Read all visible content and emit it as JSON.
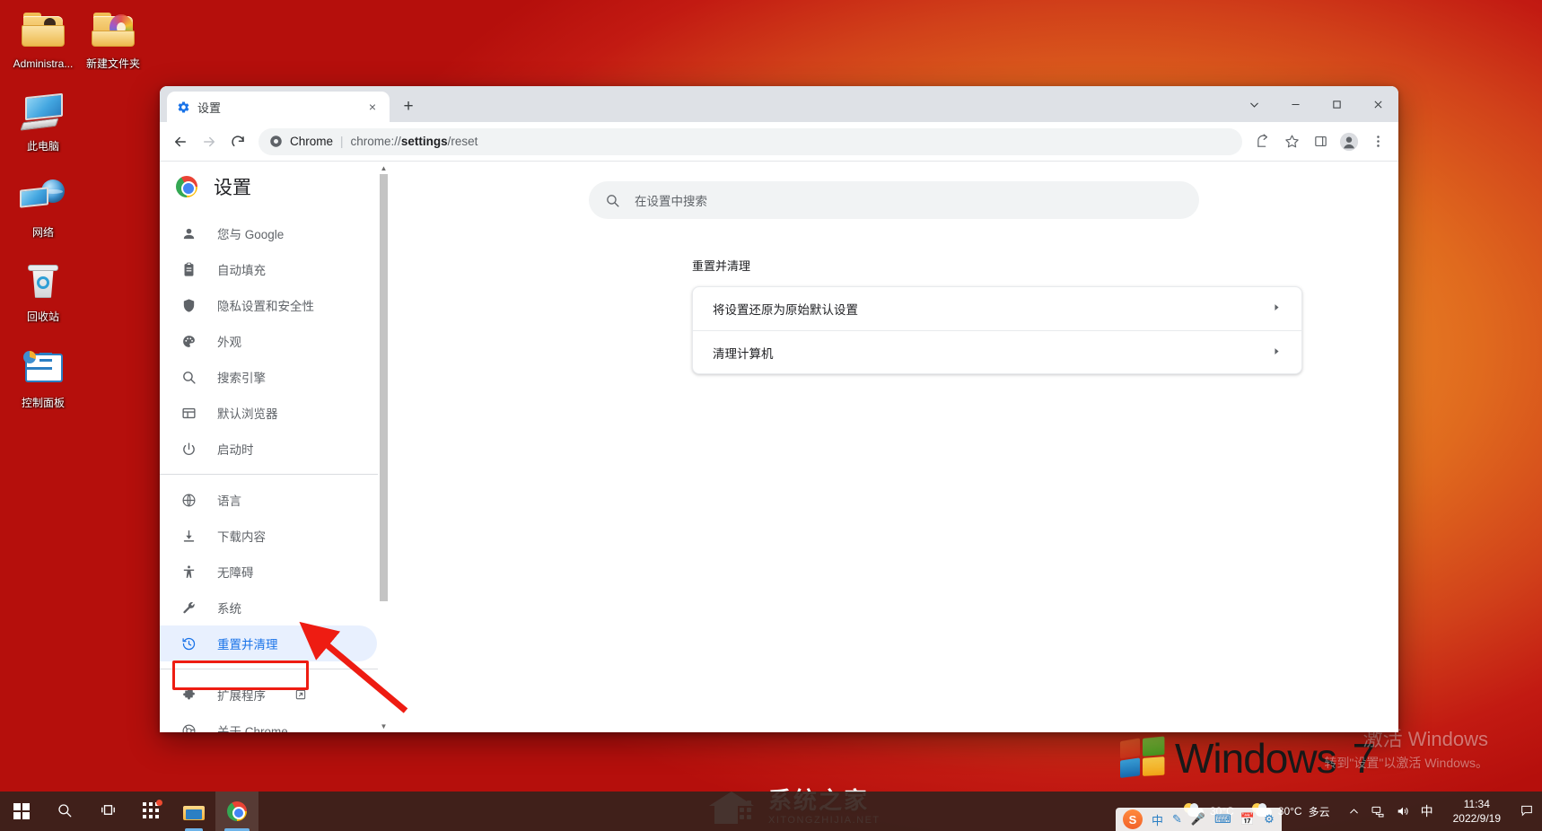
{
  "desktop": {
    "icons": [
      {
        "name": "Administra...",
        "icon": "user-folder-icon"
      },
      {
        "name": "新建文件夹",
        "icon": "folder-icon"
      },
      {
        "name": "此电脑",
        "icon": "computer-icon"
      },
      {
        "name": "网络",
        "icon": "network-icon"
      },
      {
        "name": "回收站",
        "icon": "recycle-bin-icon"
      },
      {
        "name": "控制面板",
        "icon": "control-panel-icon"
      }
    ],
    "wallpaper_brand": {
      "name": "Windows",
      "edition": "7"
    },
    "activation_watermark": {
      "line1": "激活 Windows",
      "line2": "转到\"设置\"以激活 Windows。"
    },
    "site_watermark": {
      "cn": "系统之家",
      "en": "XITONGZHIJIA.NET"
    }
  },
  "browser": {
    "tab": {
      "title": "设置",
      "favicon": "gear-icon",
      "close": "×"
    },
    "new_tab_label": "+",
    "window_controls": {
      "tab_search": "⌄",
      "minimize": "—",
      "maximize": "▫",
      "close": "✕"
    },
    "toolbar": {
      "back": "←",
      "forward": "→",
      "reload": "⟳",
      "site_chip": "Chrome",
      "separator": "|",
      "url_prefix": "chrome://",
      "url_bold": "settings",
      "url_suffix": "/reset",
      "share": "share-icon",
      "bookmark": "star-icon",
      "side_panel": "side-panel-icon",
      "profile": "avatar-icon",
      "menu": "three-dot-menu-icon"
    }
  },
  "settings": {
    "header_title": "设置",
    "search": {
      "placeholder": "在设置中搜索",
      "value": ""
    },
    "nav_groups": [
      {
        "items": [
          {
            "label": "您与 Google",
            "icon": "person-icon",
            "selected": false
          },
          {
            "label": "自动填充",
            "icon": "clipboard-icon",
            "selected": false
          },
          {
            "label": "隐私设置和安全性",
            "icon": "shield-icon",
            "selected": false
          },
          {
            "label": "外观",
            "icon": "palette-icon",
            "selected": false
          },
          {
            "label": "搜索引擎",
            "icon": "search-icon",
            "selected": false
          },
          {
            "label": "默认浏览器",
            "icon": "browser-window-icon",
            "selected": false
          },
          {
            "label": "启动时",
            "icon": "power-icon",
            "selected": false
          }
        ]
      },
      {
        "items": [
          {
            "label": "语言",
            "icon": "globe-icon",
            "selected": false
          },
          {
            "label": "下载内容",
            "icon": "download-icon",
            "selected": false
          },
          {
            "label": "无障碍",
            "icon": "accessibility-icon",
            "selected": false
          },
          {
            "label": "系统",
            "icon": "wrench-icon",
            "selected": false
          },
          {
            "label": "重置并清理",
            "icon": "history-restore-icon",
            "selected": true
          }
        ]
      },
      {
        "items": [
          {
            "label": "扩展程序",
            "icon": "puzzle-icon",
            "selected": false,
            "external": "external-link-icon"
          },
          {
            "label": "关于 Chrome",
            "icon": "chrome-icon",
            "selected": false
          }
        ]
      }
    ],
    "main": {
      "section_title": "重置并清理",
      "rows": [
        {
          "label": "将设置还原为原始默认设置",
          "chevron": "▶"
        },
        {
          "label": "清理计算机",
          "chevron": "▶"
        }
      ]
    }
  },
  "annotation": {
    "highlight_target": "重置并清理",
    "color": "#ee1c12"
  },
  "taskbar": {
    "items": [
      {
        "name": "start-button",
        "icon": "windows-logo-icon"
      },
      {
        "name": "search-button",
        "icon": "search-icon"
      },
      {
        "name": "task-view-button",
        "icon": "task-view-icon"
      },
      {
        "name": "widgets-button",
        "icon": "widgets-icon",
        "badge": true
      },
      {
        "name": "file-explorer-button",
        "icon": "file-explorer-icon"
      },
      {
        "name": "chrome-taskbar-button",
        "icon": "chrome-icon"
      }
    ],
    "weather_left": {
      "temp": "30°C"
    },
    "weather": {
      "temp": "30°C",
      "condition": "多云"
    },
    "tray": {
      "chevron": "⌃",
      "network": "network-icon",
      "volume": "volume-icon",
      "ime": "中"
    },
    "clock": {
      "time": "11:34",
      "date": "2022/9/19"
    },
    "notification": "notification-icon",
    "ime_bar": {
      "logo": "S",
      "items": [
        "中",
        "✎",
        "🎤",
        "⌨",
        "📅",
        "⚙"
      ]
    }
  }
}
